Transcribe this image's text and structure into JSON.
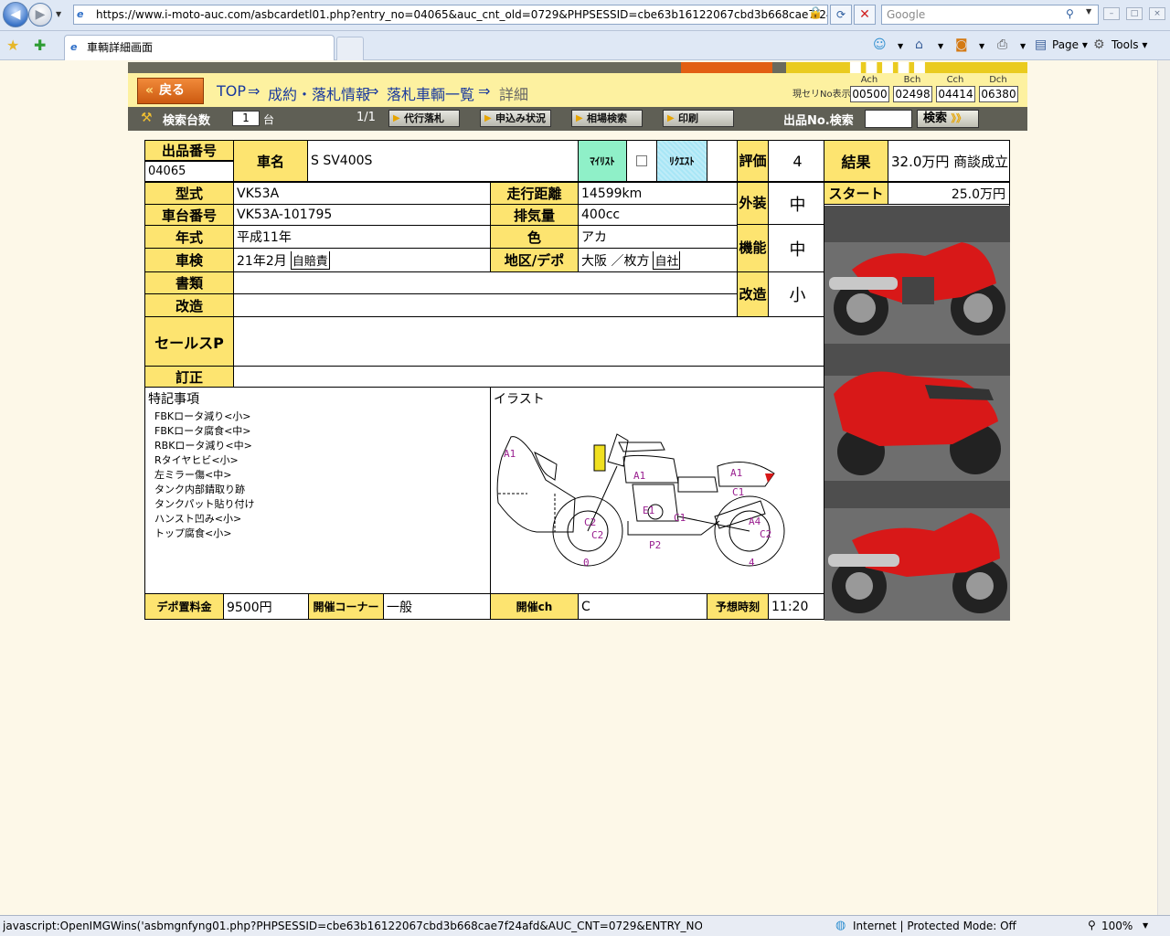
{
  "browser": {
    "url": "https://www.i-moto-auc.com/asbcardetl01.php?entry_no=04065&auc_cnt_old=0729&PHPSESSID=cbe63b16122067cbd3b668cae7f24afd&DIRE(",
    "search_placeholder": "Google",
    "tab_title": "車輌詳細画面",
    "toolbar": {
      "page": "Page",
      "tools": "Tools"
    },
    "status_text": "javascript:OpenIMGWins('asbmgnfyng01.php?PHPSESSID=cbe63b16122067cbd3b668cae7f24afd&AUC_CNT=0729&ENTRY_NO=04065&IMGNUM",
    "zone": "Internet | Protected Mode: Off",
    "zoom": "100%"
  },
  "header": {
    "back": "戻る",
    "breadcrumb": [
      "TOP",
      "⇒",
      "成約・落札情報",
      "⇒",
      "落札車輌一覧",
      "⇒",
      "詳細"
    ],
    "current_no_label": "現セリNo表示",
    "channels": [
      {
        "name": "Ach",
        "value": "00500"
      },
      {
        "name": "Bch",
        "value": "02498"
      },
      {
        "name": "Cch",
        "value": "04414"
      },
      {
        "name": "Dch",
        "value": "06380"
      }
    ]
  },
  "toolbar": {
    "count_label": "検索台数",
    "count_value": "1",
    "count_unit": "台",
    "page": "1/1",
    "buttons": [
      "代行落札",
      "申込み状況",
      "相場検索",
      "印刷"
    ],
    "no_search_label": "出品No.検索",
    "search_button": "検索",
    "search_arrows": "》》"
  },
  "vehicle": {
    "entry_no_label": "出品番号",
    "entry_no": "04065",
    "name_label": "車名",
    "name": "S SV400S",
    "mylist": "ﾏｲﾘｽﾄ",
    "request": "ﾘｸｴｽﾄ",
    "rating_label": "評価",
    "rating": "4",
    "result_label": "結果",
    "result": "32.0万円 商談成立",
    "start_label": "スタート",
    "start": "25.0万円",
    "model_label": "型式",
    "model": "VK53A",
    "mileage_label": "走行距離",
    "mileage": "14599km",
    "exterior_label": "外装",
    "exterior": "中",
    "frame_label": "車台番号",
    "frame": "VK53A-101795",
    "displacement_label": "排気量",
    "displacement": "400cc",
    "year_label": "年式",
    "year": "平成11年",
    "color_label": "色",
    "color": "アカ",
    "function_label": "機能",
    "function": "中",
    "inspection_label": "車検",
    "inspection": "21年2月",
    "inspection_stamp": "自賠責",
    "region_label": "地区/デポ",
    "region": "大阪 ／枚方",
    "region_stamp": "自社",
    "docs_label": "書類",
    "docs": "",
    "modified_label": "改造",
    "modified_rating_label": "改造",
    "modified_rating": "小",
    "sales_label": "セールスP",
    "correction_label": "訂正",
    "remarks_label": "特記事項",
    "remarks": [
      "FBKロータ減り<小>",
      "FBKロータ腐食<中>",
      "RBKロータ減り<中>",
      "Rタイヤヒビ<小>",
      "左ミラー傷<中>",
      "タンク内部錆取り跡",
      "タンクパット貼り付け",
      "ハンスト凹み<小>",
      "トップ腐食<小>"
    ],
    "illust_label": "イラスト",
    "illust_marks": [
      "A1",
      "A1",
      "A1",
      "C1",
      "E1",
      "C1",
      "A4",
      "C2",
      "C2",
      "C2",
      "P2",
      "0",
      "4"
    ],
    "depot_fee_label": "デポ置料金",
    "depot_fee": "9500円",
    "corner_label": "開催コーナー",
    "corner": "一般",
    "channel_label": "開催ch",
    "channel": "C",
    "time_label": "予想時刻",
    "time": "11:20"
  },
  "colors": {
    "label_yellow": "#fde470",
    "mylist": "#8ff0c8",
    "request": "#a8e6f6",
    "bike_red": "#d81818"
  }
}
